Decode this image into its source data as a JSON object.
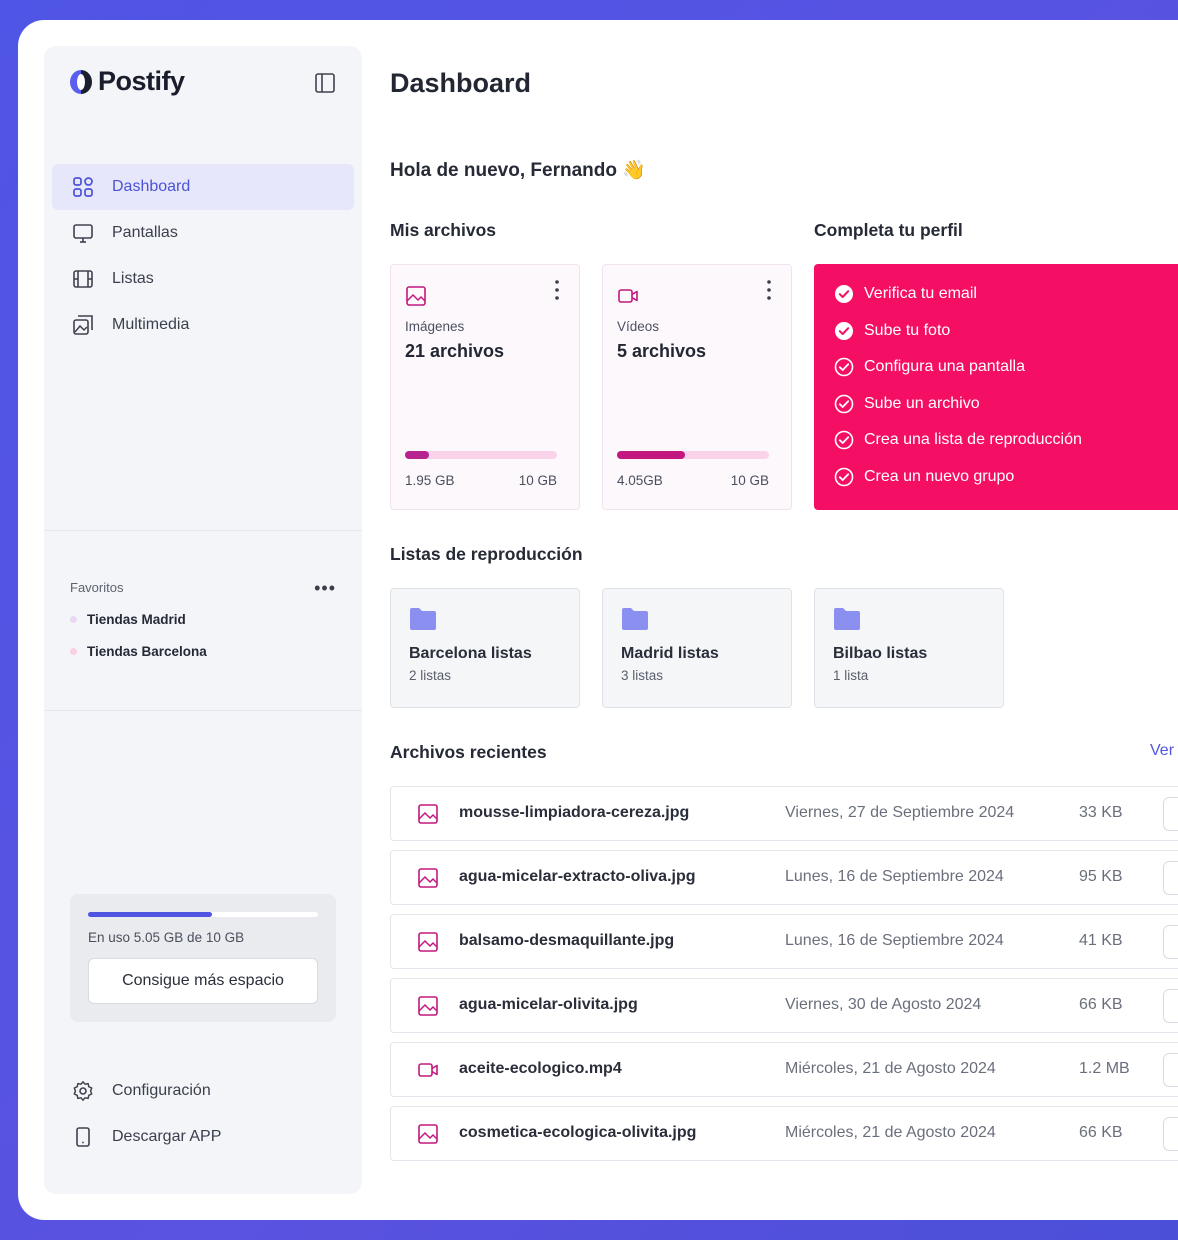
{
  "app": {
    "name": "Postify"
  },
  "colors": {
    "accent": "#4f55e0",
    "pink": "#f50f64",
    "magenta": "#c2187f",
    "lilac": "#8b8ff0",
    "bg": "#5054e3"
  },
  "nav": {
    "items": [
      {
        "label": "Dashboard",
        "icon": "grid-icon",
        "active": true
      },
      {
        "label": "Pantallas",
        "icon": "monitor-icon"
      },
      {
        "label": "Listas",
        "icon": "film-icon"
      },
      {
        "label": "Multimedia",
        "icon": "gallery-icon"
      }
    ]
  },
  "favorites": {
    "title": "Favoritos",
    "items": [
      {
        "label": "Tiendas Madrid",
        "dot_color": "#ead8f5"
      },
      {
        "label": "Tiendas Barcelona",
        "dot_color": "#f9cfe1"
      }
    ]
  },
  "storage": {
    "text": "En uso 5.05 GB de 10 GB",
    "used_fraction": 0.54,
    "button": "Consigue más espacio"
  },
  "bottom_nav": [
    {
      "label": "Configuración",
      "icon": "gear-icon"
    },
    {
      "label": "Descargar APP",
      "icon": "phone-icon"
    }
  ],
  "main": {
    "title": "Dashboard",
    "greeting": "Hola de nuevo, Fernando 👋",
    "files_title": "Mis archivos",
    "files": [
      {
        "label": "Imágenes",
        "count": "21 archivos",
        "used": "1.95 GB",
        "total": "10 GB",
        "fraction": 0.16,
        "fill_color": "#b6258f",
        "icon": "image-icon"
      },
      {
        "label": "Vídeos",
        "count": "5 archivos",
        "used": "4.05GB",
        "total": "10 GB",
        "fraction": 0.45,
        "fill_color": "#c2187f",
        "icon": "video-icon"
      }
    ],
    "profile_title": "Completa tu perfil",
    "profile_steps": [
      {
        "label": "Verifica tu email",
        "done": true
      },
      {
        "label": "Sube tu foto",
        "done": true
      },
      {
        "label": "Configura una pantalla",
        "done": false
      },
      {
        "label": "Sube un archivo",
        "done": false
      },
      {
        "label": "Crea una lista de reproducción",
        "done": false
      },
      {
        "label": "Crea un nuevo grupo",
        "done": false
      }
    ],
    "playlists_title": "Listas de reproducción",
    "playlists": [
      {
        "name": "Barcelona listas",
        "count": "2 listas"
      },
      {
        "name": "Madrid listas",
        "count": "3 listas"
      },
      {
        "name": "Bilbao listas",
        "count": "1 lista"
      }
    ],
    "recent_title": "Archivos recientes",
    "see_all": "Ver",
    "recent": [
      {
        "name": "mousse-limpiadora-cereza.jpg",
        "date": "Viernes, 27 de Septiembre 2024",
        "size": "33 KB",
        "type": "image"
      },
      {
        "name": "agua-micelar-extracto-oliva.jpg",
        "date": "Lunes, 16 de Septiembre 2024",
        "size": "95 KB",
        "type": "image"
      },
      {
        "name": "balsamo-desmaquillante.jpg",
        "date": "Lunes, 16 de Septiembre 2024",
        "size": "41 KB",
        "type": "image"
      },
      {
        "name": "agua-micelar-olivita.jpg",
        "date": "Viernes, 30 de Agosto 2024",
        "size": "66 KB",
        "type": "image"
      },
      {
        "name": "aceite-ecologico.mp4",
        "date": "Miércoles, 21 de Agosto 2024",
        "size": "1.2 MB",
        "type": "video"
      },
      {
        "name": "cosmetica-ecologica-olivita.jpg",
        "date": "Miércoles, 21 de Agosto 2024",
        "size": "66 KB",
        "type": "image"
      }
    ]
  }
}
